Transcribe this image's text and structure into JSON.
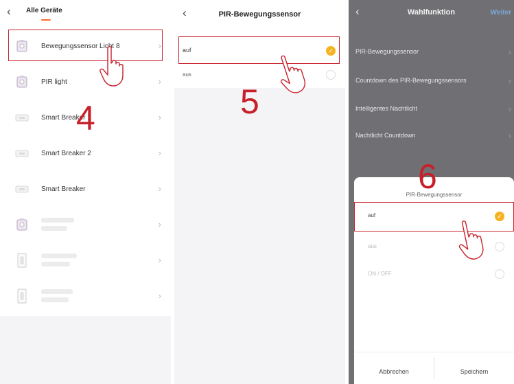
{
  "panel1": {
    "tab_label": "Alle Geräte",
    "devices": [
      {
        "label": "Bewegungssensor Licht 8",
        "icon": "sensor-light-icon"
      },
      {
        "label": "PIR light",
        "icon": "sensor-light-icon"
      },
      {
        "label": "Smart Breaker 1",
        "icon": "breaker-icon"
      },
      {
        "label": "Smart Breaker 2",
        "icon": "breaker-icon"
      },
      {
        "label": "Smart Breaker",
        "icon": "breaker-icon"
      },
      {
        "label": "",
        "icon": "sensor-light-icon"
      },
      {
        "label": "",
        "icon": "switch-icon"
      },
      {
        "label": "",
        "icon": "switch-icon"
      }
    ],
    "step": "4"
  },
  "panel2": {
    "title": "PIR-Bewegungssensor",
    "options": [
      {
        "label": "auf",
        "selected": true
      },
      {
        "label": "aus",
        "selected": false
      }
    ],
    "step": "5"
  },
  "panel3": {
    "title": "Wahlfunktion",
    "next_label": "Weiter",
    "settings": [
      "PIR-Bewegungssensor",
      "Countdown des PIR-Bewegungssensors",
      "Intelligentes Nachtlicht",
      "Nachtlicht Countdown"
    ],
    "sheet": {
      "title": "PIR-Bewegungssensor",
      "options": [
        {
          "label": "auf",
          "selected": true
        },
        {
          "label": "aus",
          "selected": false
        },
        {
          "label": "ON / OFF",
          "selected": false
        }
      ],
      "cancel_label": "Abbrechen",
      "save_label": "Speichern"
    },
    "step": "6"
  },
  "colors": {
    "highlight": "#c8202a",
    "check": "#f6b321",
    "tab_indicator": "#ff6a2a",
    "link": "#7aa7d8"
  }
}
